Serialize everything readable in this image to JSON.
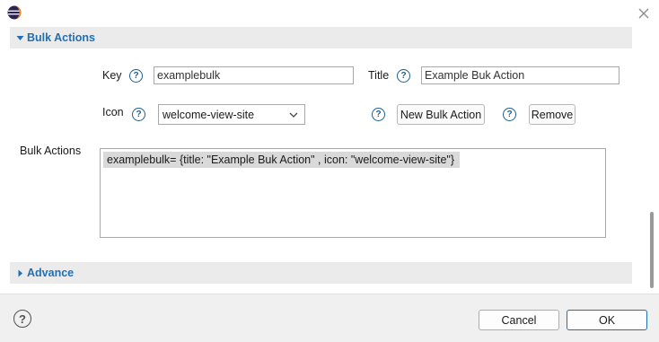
{
  "window": {
    "close_glyph": "✕"
  },
  "bulk_section": {
    "title": "Bulk Actions",
    "expanded": true
  },
  "form": {
    "key_label": "Key",
    "key_value": "examplebulk",
    "title_label": "Title",
    "title_value": "Example Buk Action",
    "icon_label": "Icon",
    "icon_value": "welcome-view-site",
    "new_button": "New Bulk Action",
    "remove_button": "Remove",
    "help_glyph": "?"
  },
  "bulk_list": {
    "label": "Bulk Actions",
    "lines": [
      "examplebulk= {title: \"Example Buk Action\" , icon: \"welcome-view-site\"}"
    ]
  },
  "advance_section": {
    "title": "Advance",
    "expanded": false
  },
  "footer": {
    "help_glyph": "?",
    "cancel_label": "Cancel",
    "ok_label": "OK"
  },
  "colors": {
    "accent": "#1f6fb5",
    "section_bg": "#ebebeb",
    "footer_bg": "#f0f0f0",
    "selection": "#d9d9d9"
  },
  "icons": [
    "eclipse-app-icon",
    "close-icon",
    "triangle-down-icon",
    "triangle-right-icon",
    "help-icon",
    "chevron-down-icon"
  ]
}
